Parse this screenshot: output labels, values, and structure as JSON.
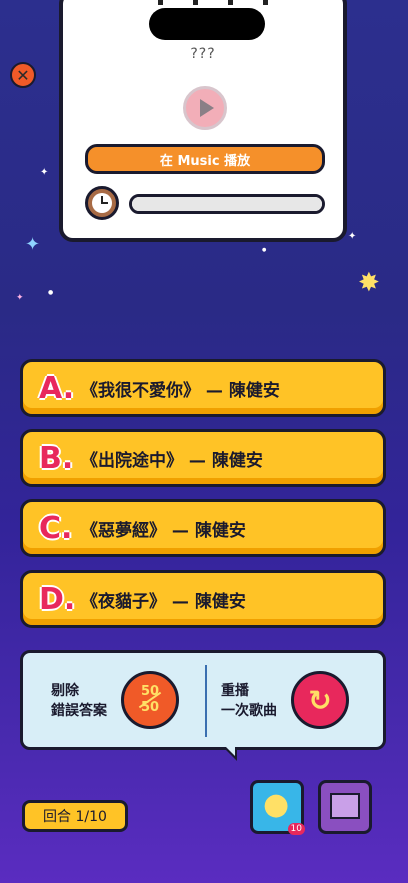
{
  "top_card": {
    "title": "???",
    "apple_glyph": "",
    "music_label": "在 Music 播放"
  },
  "options": [
    {
      "letter": "A.",
      "text": "《我很不愛你》 — 陳健安"
    },
    {
      "letter": "B.",
      "text": "《出院途中》 — 陳健安"
    },
    {
      "letter": "C.",
      "text": "《惡夢經》 — 陳健安"
    },
    {
      "letter": "D.",
      "text": "《夜貓子》 — 陳健安"
    }
  ],
  "powerups": {
    "remove_label_line1": "剔除",
    "remove_label_line2": "錯誤答案",
    "fifty_top": "50",
    "fifty_bottom": "50",
    "replay_label_line1": "重播",
    "replay_label_line2": "一次歌曲"
  },
  "footer": {
    "round_label": "回合 1/10",
    "hint_count": "10"
  },
  "colors": {
    "accent_orange": "#f5902a",
    "option_yellow": "#ffc326",
    "letter_pink": "#e8285c",
    "close_red": "#f05a28"
  }
}
